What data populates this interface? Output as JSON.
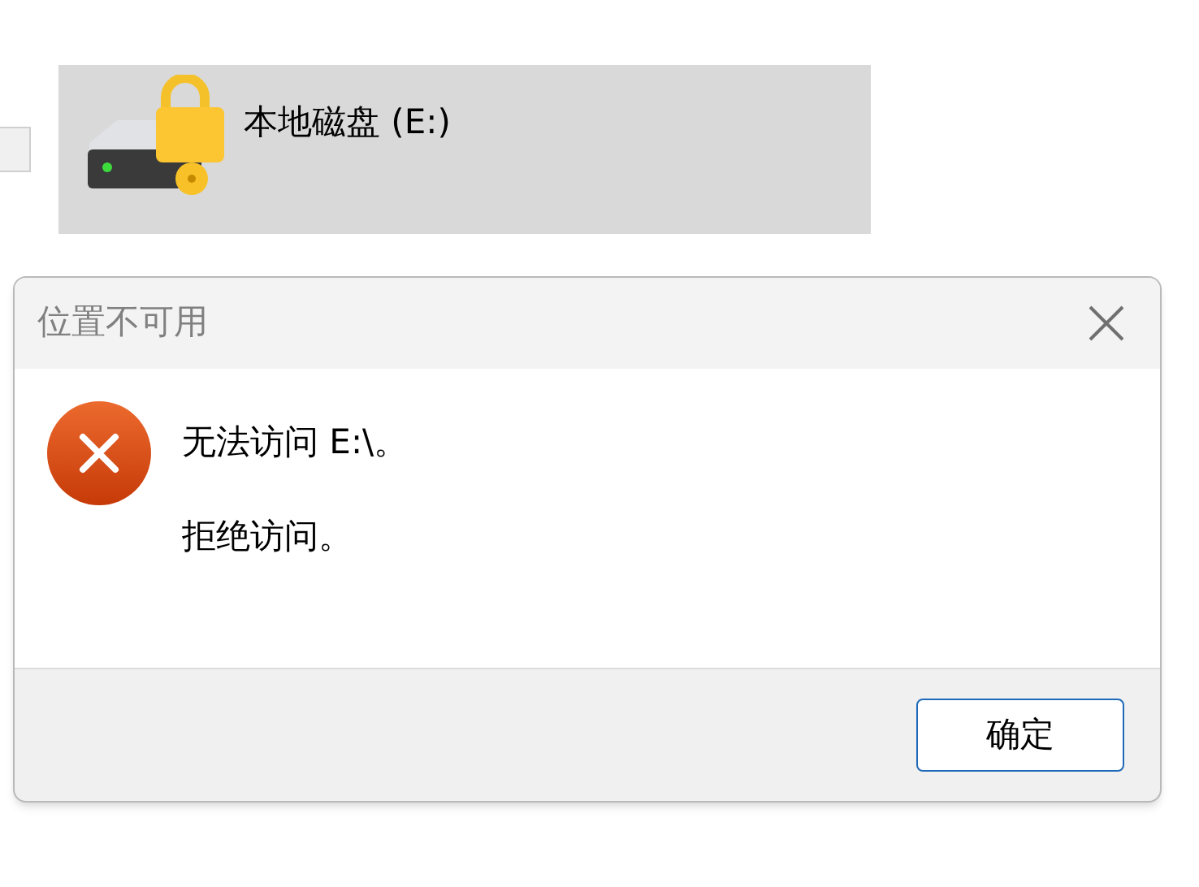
{
  "drive": {
    "label": "本地磁盘 (E:)",
    "selected": true,
    "locked": true
  },
  "dialog": {
    "title": "位置不可用",
    "messages": [
      "无法访问 E:\\。",
      "拒绝访问。"
    ],
    "buttons": [
      "确定"
    ]
  }
}
